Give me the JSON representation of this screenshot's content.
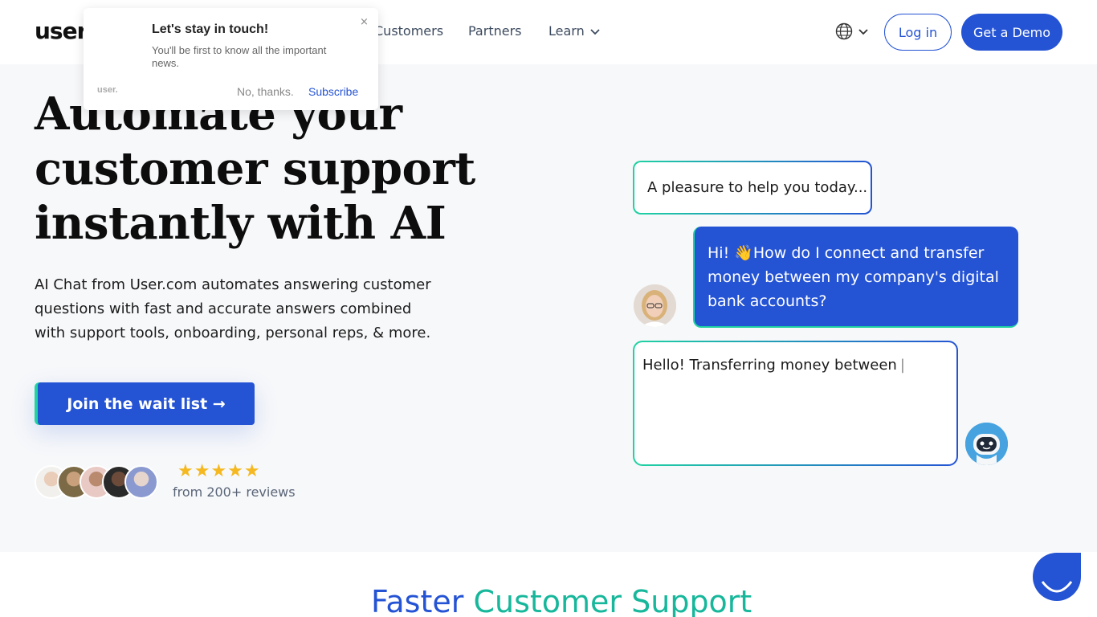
{
  "header": {
    "logo": "user",
    "nav": [
      "Customers",
      "Partners",
      "Learn"
    ],
    "login_label": "Log in",
    "demo_label": "Get a Demo",
    "language_icon": "globe-icon"
  },
  "popup": {
    "title": "Let's stay in touch!",
    "body": "You'll be first to know all the important news.",
    "close": "×",
    "brand": "user.",
    "decline": "No, thanks.",
    "subscribe": "Subscribe"
  },
  "hero": {
    "title_line1": "Automate your",
    "title_line2": "customer support",
    "title_line3": "instantly with AI",
    "subtitle": "AI Chat from User.com automates answering customer questions with fast and accurate answers combined with support tools, onboarding, personal reps, & more.",
    "cta": "Join the wait list →",
    "stars": "★★★★★",
    "reviews": "from 200+ reviews"
  },
  "chat": {
    "bot_message_1": "A pleasure to help you today...",
    "user_message": "Hi! 👋How do I connect and transfer money between my company's digital bank accounts?",
    "bot_typing": "Hello! Transferring money between",
    "cursor": "|"
  },
  "section2": {
    "title_part1": "Faster",
    "title_part2": "Customer Support"
  },
  "colors": {
    "brand_blue": "#2453d4",
    "brand_teal": "#20d3a2",
    "star": "#f5b820"
  }
}
